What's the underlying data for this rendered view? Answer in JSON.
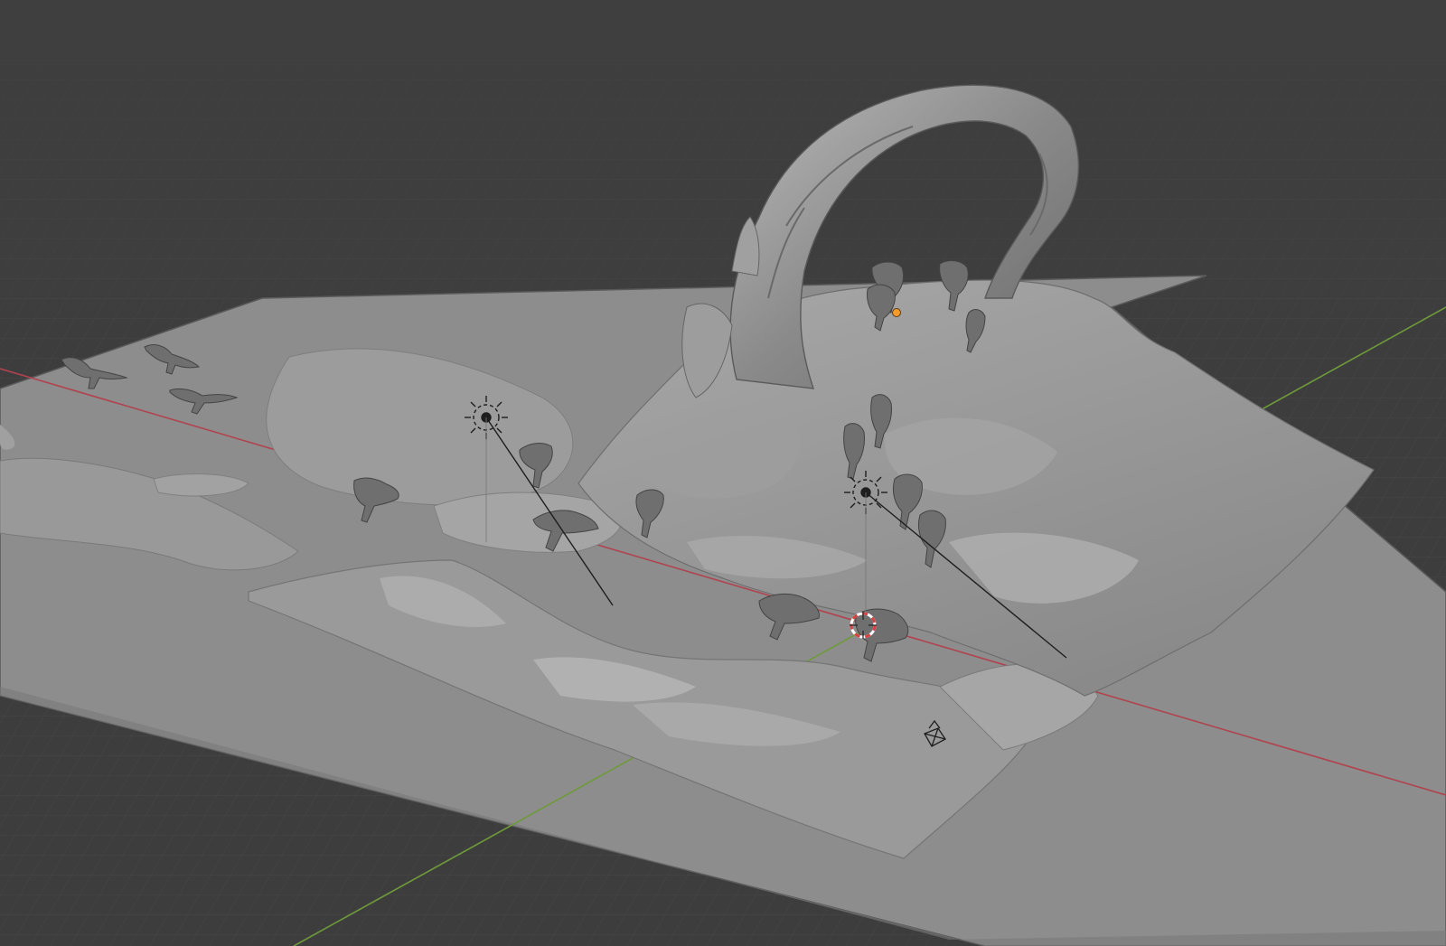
{
  "viewport": {
    "type": "3d-viewport",
    "shading": "solid",
    "background_color": "#3d3d3d",
    "grid_color": "#4a4a4a",
    "axis_x_color": "#b0434e",
    "axis_y_color": "#6e9a3a",
    "terrain_color": "#8e8e8e",
    "selected_object_origin_color": "#f29a2a",
    "cursor_color": "#d94040"
  },
  "scene_objects": [
    {
      "name": "ground-plane"
    },
    {
      "name": "terrain-mesh"
    },
    {
      "name": "rock-arch"
    },
    {
      "name": "sun-light"
    },
    {
      "name": "sun-light"
    },
    {
      "name": "dinosaur-herd"
    },
    {
      "name": "camera"
    },
    {
      "name": "3d-cursor"
    }
  ]
}
